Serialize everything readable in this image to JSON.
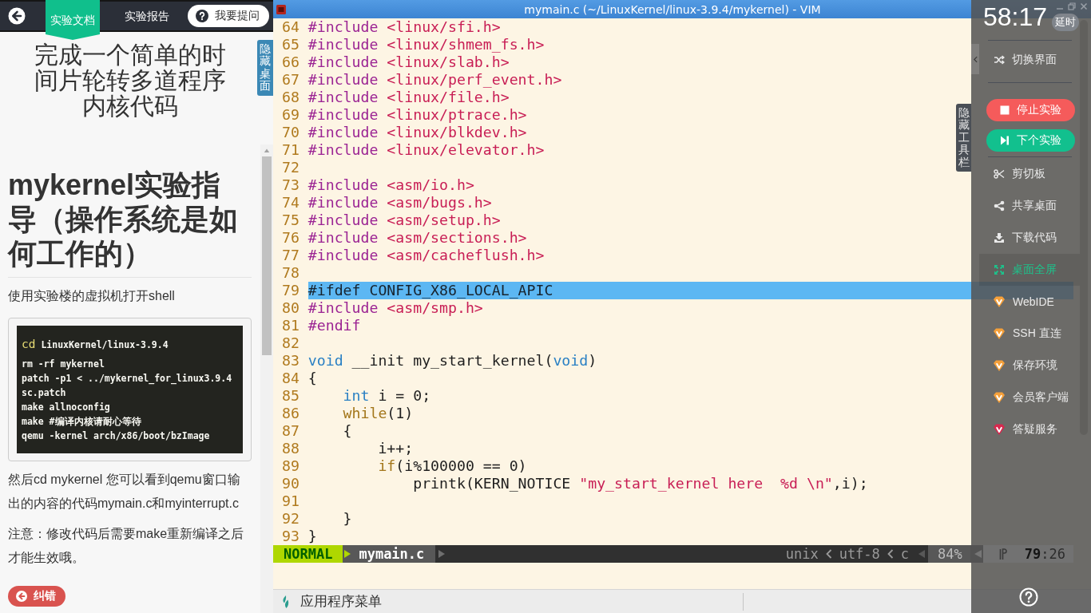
{
  "left_panel": {
    "tabs": [
      {
        "label": "实验文档",
        "selected": true
      },
      {
        "label": "实验报告",
        "selected": false
      }
    ],
    "ask_button": "我要提问",
    "title": "完成一个简单的时间片轮转多道程序内核代码",
    "hide_desktop_tab": "隐藏桌面",
    "document": {
      "heading": "mykernel实验指导（操作系统是如何工作的）",
      "blocks": [
        {
          "kind": "paragraph",
          "text": "使用实验楼的虚拟机打开shell"
        },
        {
          "kind": "code",
          "lines": [
            {
              "segments": [
                {
                  "kind": "command",
                  "text": "cd"
                },
                {
                  "kind": "text",
                  "text": " LinuxKernel/linux-3.9.4"
                }
              ]
            },
            {
              "segments": [
                {
                  "kind": "text",
                  "text": "rm -rf mykernel"
                }
              ]
            },
            {
              "segments": [
                {
                  "kind": "text",
                  "text": "patch -p1 < ../mykernel_for_linux3.9.4sc.patch"
                }
              ]
            },
            {
              "segments": [
                {
                  "kind": "text",
                  "text": "make allnoconfig"
                }
              ]
            },
            {
              "segments": [
                {
                  "kind": "text",
                  "text": "make #编译内核请耐心等待"
                }
              ]
            },
            {
              "segments": [
                {
                  "kind": "text",
                  "text": "qemu -kernel arch/x86/boot/bzImage"
                }
              ]
            }
          ]
        },
        {
          "kind": "paragraph",
          "text": "然后cd mykernel 您可以看到qemu窗口输出的内容的代码mymain.c和myinterrupt.c"
        },
        {
          "kind": "paragraph",
          "text": "注意：修改代码后需要make重新编译之后才能生效哦。"
        }
      ]
    },
    "report_button": "纠错"
  },
  "vim": {
    "title": "mymain.c (~/LinuxKernel/linux-3.9.4/mykernel) - VIM",
    "lines": [
      {
        "number": "64",
        "highlighted": false,
        "segments": [
          {
            "kind": "preproc",
            "text": "#include"
          },
          {
            "kind": "header",
            "text": " <linux/sfi.h>"
          }
        ]
      },
      {
        "number": "65",
        "highlighted": false,
        "segments": [
          {
            "kind": "preproc",
            "text": "#include"
          },
          {
            "kind": "header",
            "text": " <linux/shmem_fs.h>"
          }
        ]
      },
      {
        "number": "66",
        "highlighted": false,
        "segments": [
          {
            "kind": "preproc",
            "text": "#include"
          },
          {
            "kind": "header",
            "text": " <linux/slab.h>"
          }
        ]
      },
      {
        "number": "67",
        "highlighted": false,
        "segments": [
          {
            "kind": "preproc",
            "text": "#include"
          },
          {
            "kind": "header",
            "text": " <linux/perf_event.h>"
          }
        ]
      },
      {
        "number": "68",
        "highlighted": false,
        "segments": [
          {
            "kind": "preproc",
            "text": "#include"
          },
          {
            "kind": "header",
            "text": " <linux/file.h>"
          }
        ]
      },
      {
        "number": "69",
        "highlighted": false,
        "segments": [
          {
            "kind": "preproc",
            "text": "#include"
          },
          {
            "kind": "header",
            "text": " <linux/ptrace.h>"
          }
        ]
      },
      {
        "number": "70",
        "highlighted": false,
        "segments": [
          {
            "kind": "preproc",
            "text": "#include"
          },
          {
            "kind": "header",
            "text": " <linux/blkdev.h>"
          }
        ]
      },
      {
        "number": "71",
        "highlighted": false,
        "segments": [
          {
            "kind": "preproc",
            "text": "#include"
          },
          {
            "kind": "header",
            "text": " <linux/elevator.h>"
          }
        ]
      },
      {
        "number": "72",
        "highlighted": false
      },
      {
        "number": "73",
        "highlighted": false,
        "segments": [
          {
            "kind": "preproc",
            "text": "#include"
          },
          {
            "kind": "header",
            "text": " <asm/io.h>"
          }
        ]
      },
      {
        "number": "74",
        "highlighted": false,
        "segments": [
          {
            "kind": "preproc",
            "text": "#include"
          },
          {
            "kind": "header",
            "text": " <asm/bugs.h>"
          }
        ]
      },
      {
        "number": "75",
        "highlighted": false,
        "segments": [
          {
            "kind": "preproc",
            "text": "#include"
          },
          {
            "kind": "header",
            "text": " <asm/setup.h>"
          }
        ]
      },
      {
        "number": "76",
        "highlighted": false,
        "segments": [
          {
            "kind": "preproc",
            "text": "#include"
          },
          {
            "kind": "header",
            "text": " <asm/sections.h>"
          }
        ]
      },
      {
        "number": "77",
        "highlighted": false,
        "segments": [
          {
            "kind": "preproc",
            "text": "#include"
          },
          {
            "kind": "header",
            "text": " <asm/cacheflush.h>"
          }
        ]
      },
      {
        "number": "78",
        "highlighted": false
      },
      {
        "number": "79",
        "highlighted": true,
        "segments": [
          {
            "kind": "preproc",
            "text": "#ifdef"
          },
          {
            "kind": "text",
            "text": " CONFIG_X86_LOCAL_APIC"
          }
        ]
      },
      {
        "number": "80",
        "highlighted": false,
        "segments": [
          {
            "kind": "preproc",
            "text": "#include"
          },
          {
            "kind": "header",
            "text": " <asm/smp.h>"
          }
        ]
      },
      {
        "number": "81",
        "highlighted": false,
        "segments": [
          {
            "kind": "preproc",
            "text": "#endif"
          }
        ]
      },
      {
        "number": "82",
        "highlighted": false
      },
      {
        "number": "83",
        "highlighted": false,
        "segments": [
          {
            "kind": "type",
            "text": "void"
          },
          {
            "kind": "text",
            "text": " __init my_start_kernel("
          },
          {
            "kind": "type",
            "text": "void"
          },
          {
            "kind": "text",
            "text": ")"
          }
        ]
      },
      {
        "number": "84",
        "highlighted": false,
        "segments": [
          {
            "kind": "text",
            "text": "{"
          }
        ]
      },
      {
        "number": "85",
        "highlighted": false,
        "segments": [
          {
            "kind": "type",
            "text": "    int"
          },
          {
            "kind": "text",
            "text": " i = 0;"
          }
        ]
      },
      {
        "number": "86",
        "highlighted": false,
        "segments": [
          {
            "kind": "keyword",
            "text": "    while"
          },
          {
            "kind": "text",
            "text": "(1)"
          }
        ]
      },
      {
        "number": "87",
        "highlighted": false,
        "segments": [
          {
            "kind": "text",
            "text": "    {"
          }
        ]
      },
      {
        "number": "88",
        "highlighted": false,
        "segments": [
          {
            "kind": "text",
            "text": "        i++;"
          }
        ]
      },
      {
        "number": "89",
        "highlighted": false,
        "segments": [
          {
            "kind": "keyword",
            "text": "        if"
          },
          {
            "kind": "text",
            "text": "(i%100000 == 0)"
          }
        ]
      },
      {
        "number": "90",
        "highlighted": false,
        "segments": [
          {
            "kind": "text",
            "text": "            printk(KERN_NOTICE "
          },
          {
            "kind": "string",
            "text": "\"my_start_kernel here  %d \\n\""
          },
          {
            "kind": "text",
            "text": ",i);"
          }
        ]
      },
      {
        "number": "91",
        "highlighted": false
      },
      {
        "number": "92",
        "highlighted": false,
        "segments": [
          {
            "kind": "text",
            "text": "    }"
          }
        ]
      },
      {
        "number": "93",
        "highlighted": false,
        "segments": [
          {
            "kind": "text",
            "text": "}"
          }
        ]
      }
    ],
    "status_line": {
      "mode": "NORMAL",
      "file": "mymain.c",
      "fileformat": "unix",
      "encoding": "utf-8",
      "filetype": "c",
      "percent": "84%",
      "position": "**79**:26"
    }
  },
  "desktop": {
    "hide_toolbar_tab": "隐藏工具栏",
    "taskbar": {
      "menu_label": "应用程序菜单"
    }
  },
  "sidebar": {
    "timer": "58:17",
    "extend_button": "延时",
    "sections": [
      {
        "items": [
          {
            "kind": "link",
            "label": "切换界面",
            "active": false
          }
        ]
      },
      {
        "items": [
          {
            "kind": "danger_button",
            "label": "停止实验",
            "active": false
          },
          {
            "kind": "success_button",
            "label": "下个实验",
            "active": false
          }
        ]
      },
      {
        "items": [
          {
            "kind": "link",
            "label": "剪切板",
            "active": false
          },
          {
            "kind": "link",
            "label": "共享桌面",
            "active": false
          },
          {
            "kind": "link",
            "label": "下载代码",
            "active": false
          },
          {
            "kind": "link",
            "label": "桌面全屏",
            "active": true
          },
          {
            "kind": "premium",
            "label": "WebIDE",
            "active": false,
            "color": "#f5a03a"
          },
          {
            "kind": "premium",
            "label": "SSH 直连",
            "active": false,
            "color": "#f5a03a"
          },
          {
            "kind": "premium",
            "label": "保存环境",
            "active": false,
            "color": "#f5a03a"
          },
          {
            "kind": "premium",
            "label": "会员客户端",
            "active": false,
            "color": "#f5a03a"
          },
          {
            "kind": "premium",
            "label": "答疑服务",
            "active": false,
            "color": "#d8284e"
          }
        ]
      }
    ]
  }
}
